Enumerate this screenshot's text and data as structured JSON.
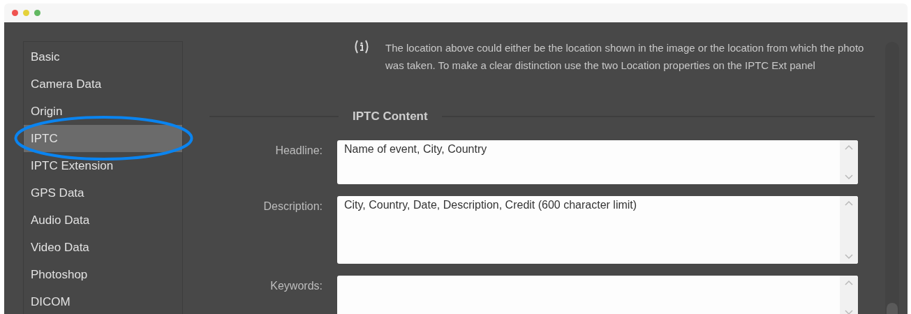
{
  "sidebar": {
    "items": [
      {
        "label": "Basic",
        "selected": false
      },
      {
        "label": "Camera Data",
        "selected": false
      },
      {
        "label": "Origin",
        "selected": false
      },
      {
        "label": "IPTC",
        "selected": true
      },
      {
        "label": "IPTC Extension",
        "selected": false
      },
      {
        "label": "GPS Data",
        "selected": false
      },
      {
        "label": "Audio Data",
        "selected": false
      },
      {
        "label": "Video Data",
        "selected": false
      },
      {
        "label": "Photoshop",
        "selected": false
      },
      {
        "label": "DICOM",
        "selected": false
      }
    ]
  },
  "info_note": {
    "text": "The location above could either be the location shown in the image or the location from which the photo was taken. To make a clear distinction use the two Location properties on the IPTC Ext panel"
  },
  "section": {
    "title": "IPTC Content"
  },
  "fields": [
    {
      "label": "Headline:",
      "value": "Name of event, City, Country"
    },
    {
      "label": "Description:",
      "value": "City, Country, Date, Description, Credit (600 character limit)"
    },
    {
      "label": "Keywords:"
    }
  ]
}
